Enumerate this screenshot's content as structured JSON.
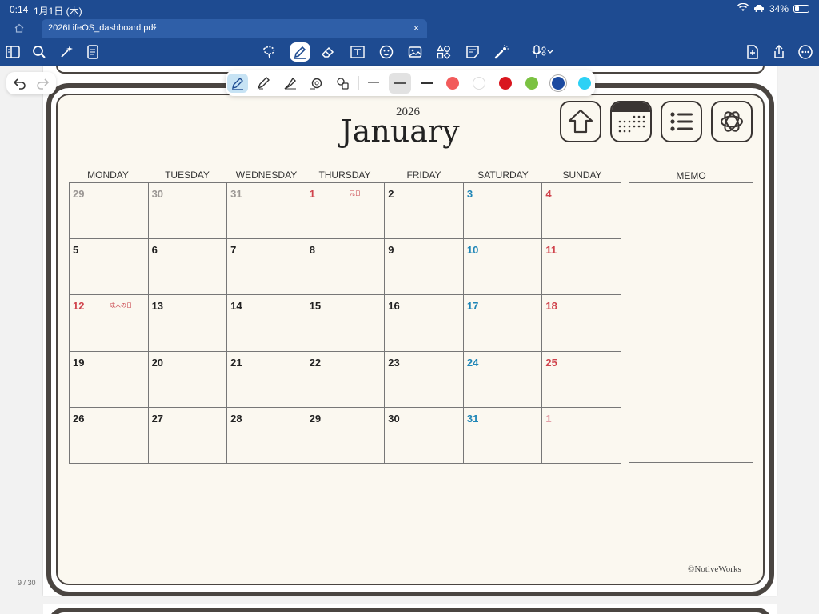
{
  "status": {
    "time": "0:14",
    "date": "1月1日 (木)",
    "battery_text": "34%",
    "battery_level": 0.34
  },
  "tab": {
    "title": "2026LifeOS_dashboard.pdf",
    "chevron": "⌄",
    "close": "×"
  },
  "toolbar": {
    "icons": [
      "sidebar-icon",
      "search-icon",
      "sparkle-icon",
      "notes-icon",
      "lasso-icon",
      "pen-icon",
      "eraser-icon",
      "textbox-icon",
      "sticker-icon",
      "image-icon",
      "shapes-icon",
      "sticky-note-icon",
      "laser-icon",
      "microphone-icon",
      "new-page-icon",
      "share-icon",
      "more-icon"
    ],
    "active": "pen-icon"
  },
  "palette": {
    "tools": [
      "fountain-pen-icon",
      "ballpoint-pen-icon",
      "brush-pen-icon",
      "highlighter-icon",
      "sticker-pen-icon"
    ],
    "active_tool": "fountain-pen-icon",
    "stroke_widths": [
      "thin",
      "medium",
      "thick"
    ],
    "selected_stroke": "medium",
    "colors": [
      "#f25b5b",
      "#ffffff",
      "#d9161e",
      "#7bc242",
      "#1c4aa0",
      "#2dd1f5"
    ],
    "selected_color": "#1c4aa0"
  },
  "calendar": {
    "year": "2026",
    "month": "January",
    "weekdays": [
      "MONDAY",
      "TUESDAY",
      "WEDNESDAY",
      "THURSDAY",
      "FRIDAY",
      "SATURDAY",
      "SUNDAY"
    ],
    "memo_label": "MEMO",
    "weeks": [
      [
        {
          "d": "29",
          "c": "muted"
        },
        {
          "d": "30",
          "c": "muted"
        },
        {
          "d": "31",
          "c": "muted"
        },
        {
          "d": "1",
          "c": "red",
          "h": "元日"
        },
        {
          "d": "2",
          "c": ""
        },
        {
          "d": "3",
          "c": "blue"
        },
        {
          "d": "4",
          "c": "red"
        }
      ],
      [
        {
          "d": "5",
          "c": ""
        },
        {
          "d": "6",
          "c": ""
        },
        {
          "d": "7",
          "c": ""
        },
        {
          "d": "8",
          "c": ""
        },
        {
          "d": "9",
          "c": ""
        },
        {
          "d": "10",
          "c": "blue"
        },
        {
          "d": "11",
          "c": "red"
        }
      ],
      [
        {
          "d": "12",
          "c": "red",
          "h": "成人の日"
        },
        {
          "d": "13",
          "c": ""
        },
        {
          "d": "14",
          "c": ""
        },
        {
          "d": "15",
          "c": ""
        },
        {
          "d": "16",
          "c": ""
        },
        {
          "d": "17",
          "c": "blue"
        },
        {
          "d": "18",
          "c": "red"
        }
      ],
      [
        {
          "d": "19",
          "c": ""
        },
        {
          "d": "20",
          "c": ""
        },
        {
          "d": "21",
          "c": ""
        },
        {
          "d": "22",
          "c": ""
        },
        {
          "d": "23",
          "c": ""
        },
        {
          "d": "24",
          "c": "blue"
        },
        {
          "d": "25",
          "c": "red"
        }
      ],
      [
        {
          "d": "26",
          "c": ""
        },
        {
          "d": "27",
          "c": ""
        },
        {
          "d": "28",
          "c": ""
        },
        {
          "d": "29",
          "c": ""
        },
        {
          "d": "30",
          "c": ""
        },
        {
          "d": "31",
          "c": "blue"
        },
        {
          "d": "1",
          "c": "pink"
        }
      ]
    ],
    "nav_icons": [
      "home-icon",
      "calendar-icon",
      "list-icon",
      "chatgpt-icon"
    ],
    "copyright": "©NotiveWorks"
  },
  "page_indicator": "9 / 30"
}
